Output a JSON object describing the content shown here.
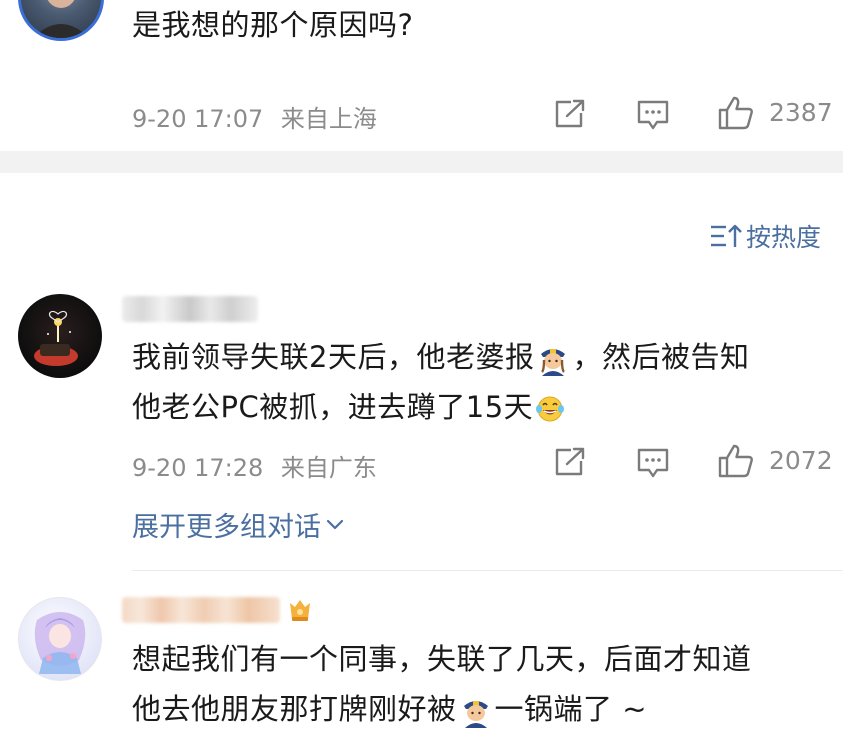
{
  "comments": [
    {
      "text_line1": "是我想的那个原因吗?",
      "time": "9-20 17:07",
      "location": "来自上海",
      "likes": "2387"
    },
    {
      "text_line1_a": "我前领导失联2天后，他老婆报",
      "text_line1_b": "，然后被告知",
      "text_line2": "他老公PC被抓，进去蹲了15天",
      "time": "9-20 17:28",
      "location": "来自广东",
      "likes": "2072",
      "expand_label": "展开更多组对话"
    },
    {
      "text_line1": "想起我们有一个同事，失联了几天，后面才知道",
      "text_line2_a": "他去他朋友那打牌刚好被",
      "text_line2_b": "一锅端了 ~"
    }
  ],
  "sort": {
    "label": "按热度",
    "icon": "sort-icon"
  },
  "icons": {
    "share": "share-icon",
    "comment": "comment-icon",
    "like": "thumbs-up-icon",
    "police_emoji": "police-officer-emoji",
    "laugh_emoji": "tears-of-joy-emoji",
    "chevron": "chevron-down-icon"
  },
  "colors": {
    "link": "#4a6fa0",
    "meta": "#8b8b8b",
    "separator": "#f2f2f2"
  }
}
